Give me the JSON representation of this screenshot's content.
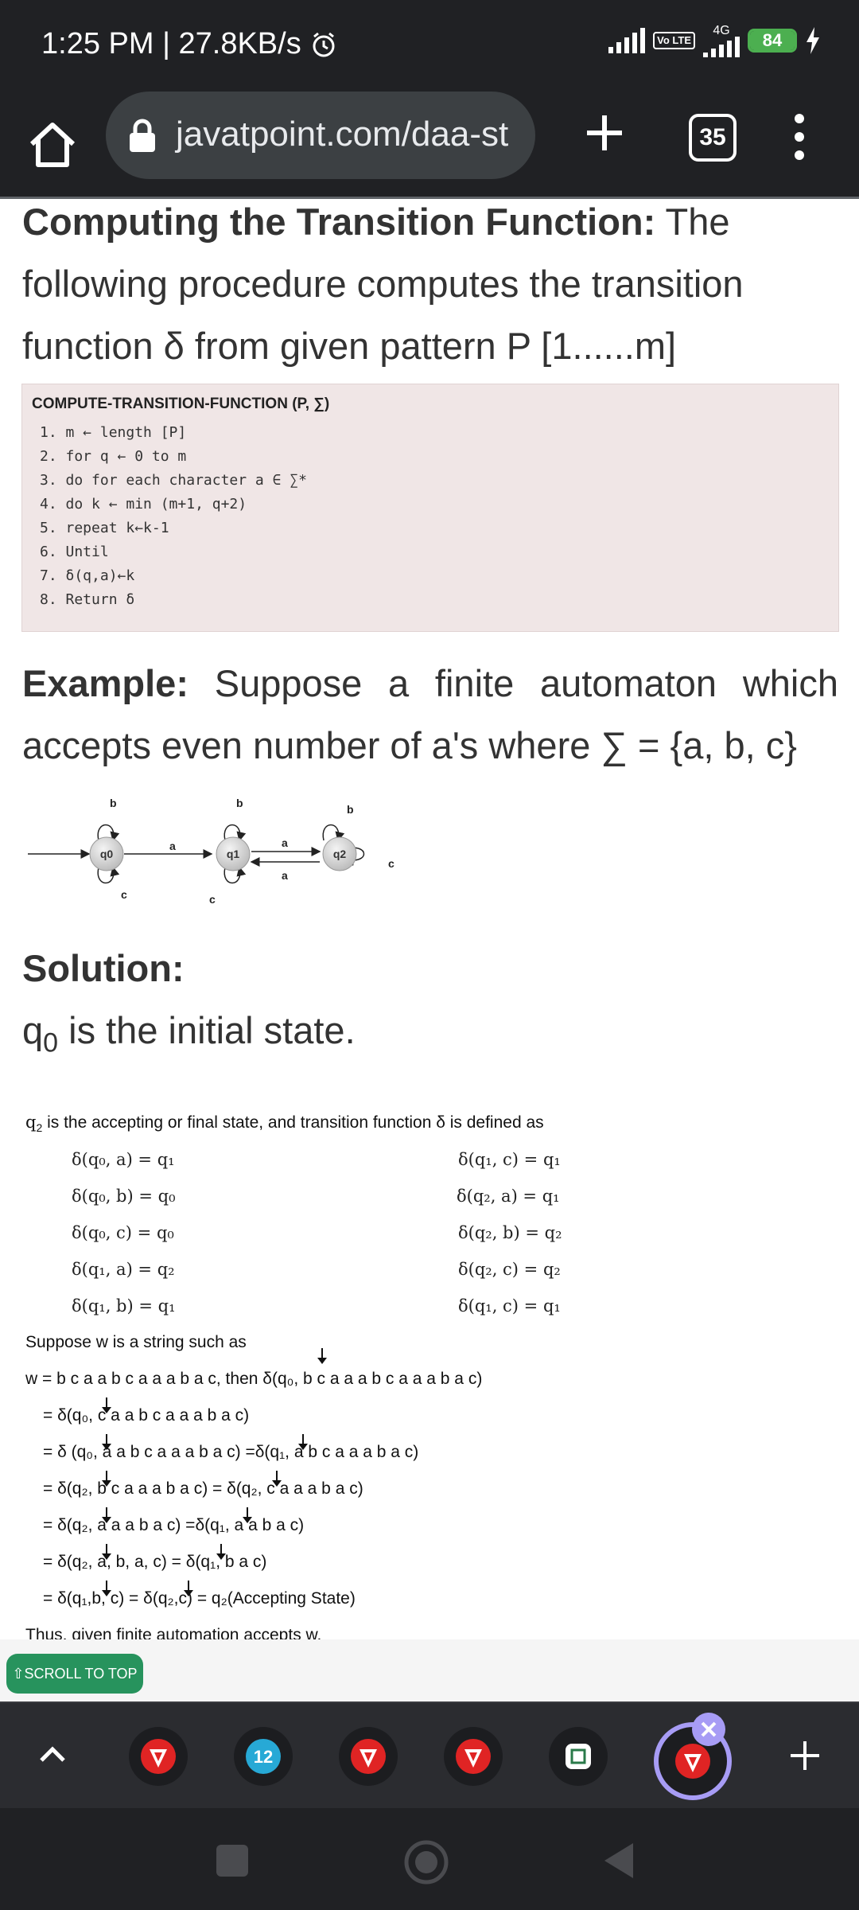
{
  "status": {
    "time_speed": "1:25 PM | 27.8KB/s",
    "volte": "Vo LTE",
    "network": "4G",
    "battery": "84"
  },
  "browser": {
    "url": "javatpoint.com/daa-st",
    "tab_count": "35"
  },
  "article": {
    "heading_bold": "Computing the Transition Function:",
    "heading_rest": " The following procedure computes the transition function δ from given pattern P [1......m]",
    "code_title": "COMPUTE-TRANSITION-FUNCTION (P, ∑)",
    "code_lines": [
      "1. m ← length [P]",
      "2. for q ← 0 to m",
      "3. do for each character a ∈ ∑*",
      "4. do k ← min (m+1, q+2)",
      "5. repeat k←k-1",
      "6. Until",
      "7. δ(q,a)←k",
      "8. Return δ"
    ],
    "example_bold": "Example:",
    "example_rest": " Suppose a finite automaton which accepts even number of a's where ∑ = {a, b, c}",
    "diagram": {
      "states": [
        "q0",
        "q1",
        "q2"
      ],
      "labels": [
        "b",
        "b",
        "b",
        "a",
        "a",
        "a",
        "c",
        "c",
        "c"
      ]
    },
    "solution_label": "Solution:",
    "initial_state_text": " is the initial state.",
    "initial_state_q": "q",
    "initial_state_sub": "0",
    "accepting_text": "is the accepting or final state, and transition function δ is defined as",
    "accepting_q": "q",
    "accepting_sub": "2",
    "transitions_left": [
      "δ(q₀, a) = q₁",
      "δ(q₀, b) = q₀",
      "δ(q₀, c) = q₀",
      "δ(q₁, a) = q₂",
      "δ(q₁, b) = q₁"
    ],
    "transitions_right": [
      "δ(q₁, c) = q₁",
      "δ(q₂, a) = q₁",
      "δ(q₂, b) = q₂",
      "δ(q₂, c) = q₂",
      "δ(q₁, c) = q₁"
    ],
    "suppose_text": "Suppose w is a string such as",
    "derivation": [
      "w = b c a a b c a a a b a c, then    δ(q₀, b c a a a b c a a a b a c)",
      "= δ(q₀, c a a b c a a a b a c)",
      "= δ (q₀, a a b c a a a b a c) =δ(q₁, a b c a a a b a c)",
      "= δ(q₂, b c a a a b a c) = δ(q₂, c a a a b a c)",
      "= δ(q₂, a a a b a c) =δ(q₁, a a b a c)",
      "= δ(q₂, a, b, a, c) = δ(q₁, b a c)",
      "= δ(q₁,b, c) = δ(q₂,c) = q₂(Accepting State)"
    ],
    "thus_text": "Thus, given finite automation accepts w."
  },
  "scroll_top_label": "⇧SCROLL TO TOP",
  "colors": {
    "chrome_bg": "#202124",
    "scroll_button": "#27935d",
    "tab_active_ring": "#a79cf5",
    "tab_icon_red": "#e02424"
  }
}
